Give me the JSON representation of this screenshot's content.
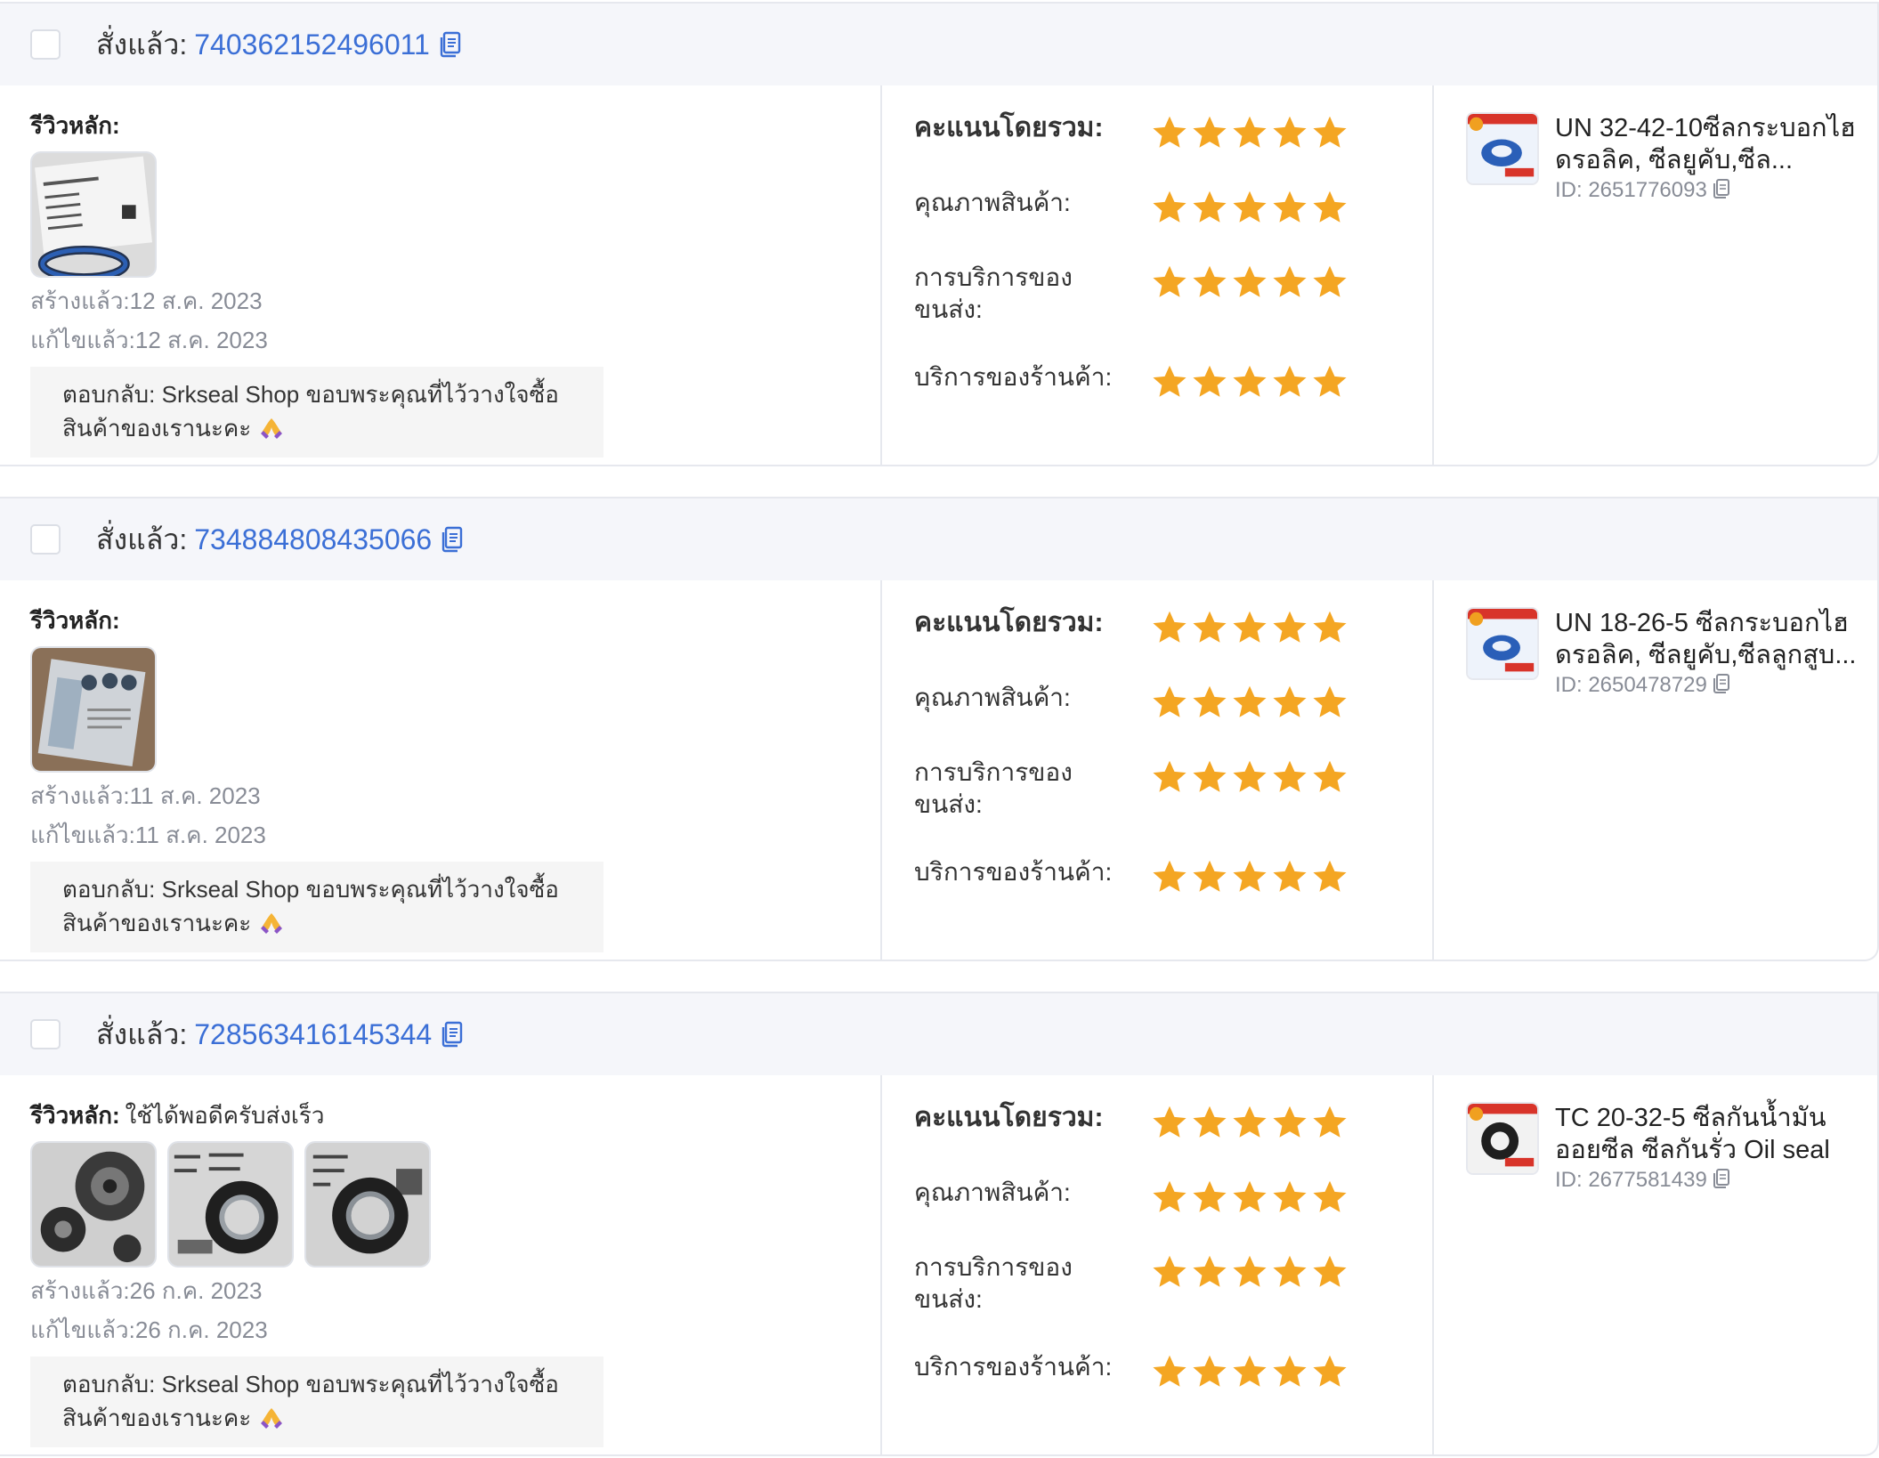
{
  "labels": {
    "ordered": "สั่งแล้ว:",
    "main_review": "รีวิวหลัก:",
    "overall": "คะแนนโดยรวม:",
    "quality": "คุณภาพสินค้า:",
    "shipping": "การบริการของขนส่ง:",
    "shop_service": "บริการของร้านค้า:",
    "id_prefix": "ID:"
  },
  "icons": {
    "copy": "copy-icon",
    "star": "star-icon",
    "checkbox": "checkbox",
    "reply_emoji": "folded-hands-icon"
  },
  "colors": {
    "link": "#3b6fd6",
    "star": "#f4a623",
    "header_bg": "#f5f6fa",
    "muted": "#888c96"
  },
  "orders": [
    {
      "order_id": "740362152496011",
      "review_text": "",
      "created": "สร้างแล้ว:12 ส.ค. 2023",
      "edited": "แก้ไขแล้ว:12 ส.ค. 2023",
      "reply": "ตอบกลับ: Srkseal Shop ขอบพระคุณที่ไว้วางใจซื้อสินค้าของเรานะคะ",
      "ratings": {
        "overall": 5,
        "quality": 5,
        "shipping": 5,
        "shop_service": 5
      },
      "product": {
        "title": "UN 32-42-10ซีลกระบอกไฮดรอลิค, ซีลยูคับ,ซีล...",
        "id": "ID: 2651776093"
      }
    },
    {
      "order_id": "734884808435066",
      "review_text": "",
      "created": "สร้างแล้ว:11 ส.ค. 2023",
      "edited": "แก้ไขแล้ว:11 ส.ค. 2023",
      "reply": "ตอบกลับ: Srkseal Shop ขอบพระคุณที่ไว้วางใจซื้อสินค้าของเรานะคะ",
      "ratings": {
        "overall": 5,
        "quality": 5,
        "shipping": 5,
        "shop_service": 5
      },
      "product": {
        "title": "UN 18-26-5 ซีลกระบอกไฮดรอลิค, ซีลยูคับ,ซีลลูกสูบ...",
        "id": "ID: 2650478729"
      }
    },
    {
      "order_id": "728563416145344",
      "review_text": "ใช้ได้พอดีครับส่งเร็ว",
      "created": "สร้างแล้ว:26 ก.ค. 2023",
      "edited": "แก้ไขแล้ว:26 ก.ค. 2023",
      "reply": "ตอบกลับ: Srkseal Shop ขอบพระคุณที่ไว้วางใจซื้อสินค้าของเรานะคะ",
      "ratings": {
        "overall": 5,
        "quality": 5,
        "shipping": 5,
        "shop_service": 5
      },
      "product": {
        "title": "TC 20-32-5 ซีลกันน้ำมัน ออยซีล ซีลกันรั่ว Oil seal",
        "id": "ID: 2677581439"
      }
    }
  ]
}
